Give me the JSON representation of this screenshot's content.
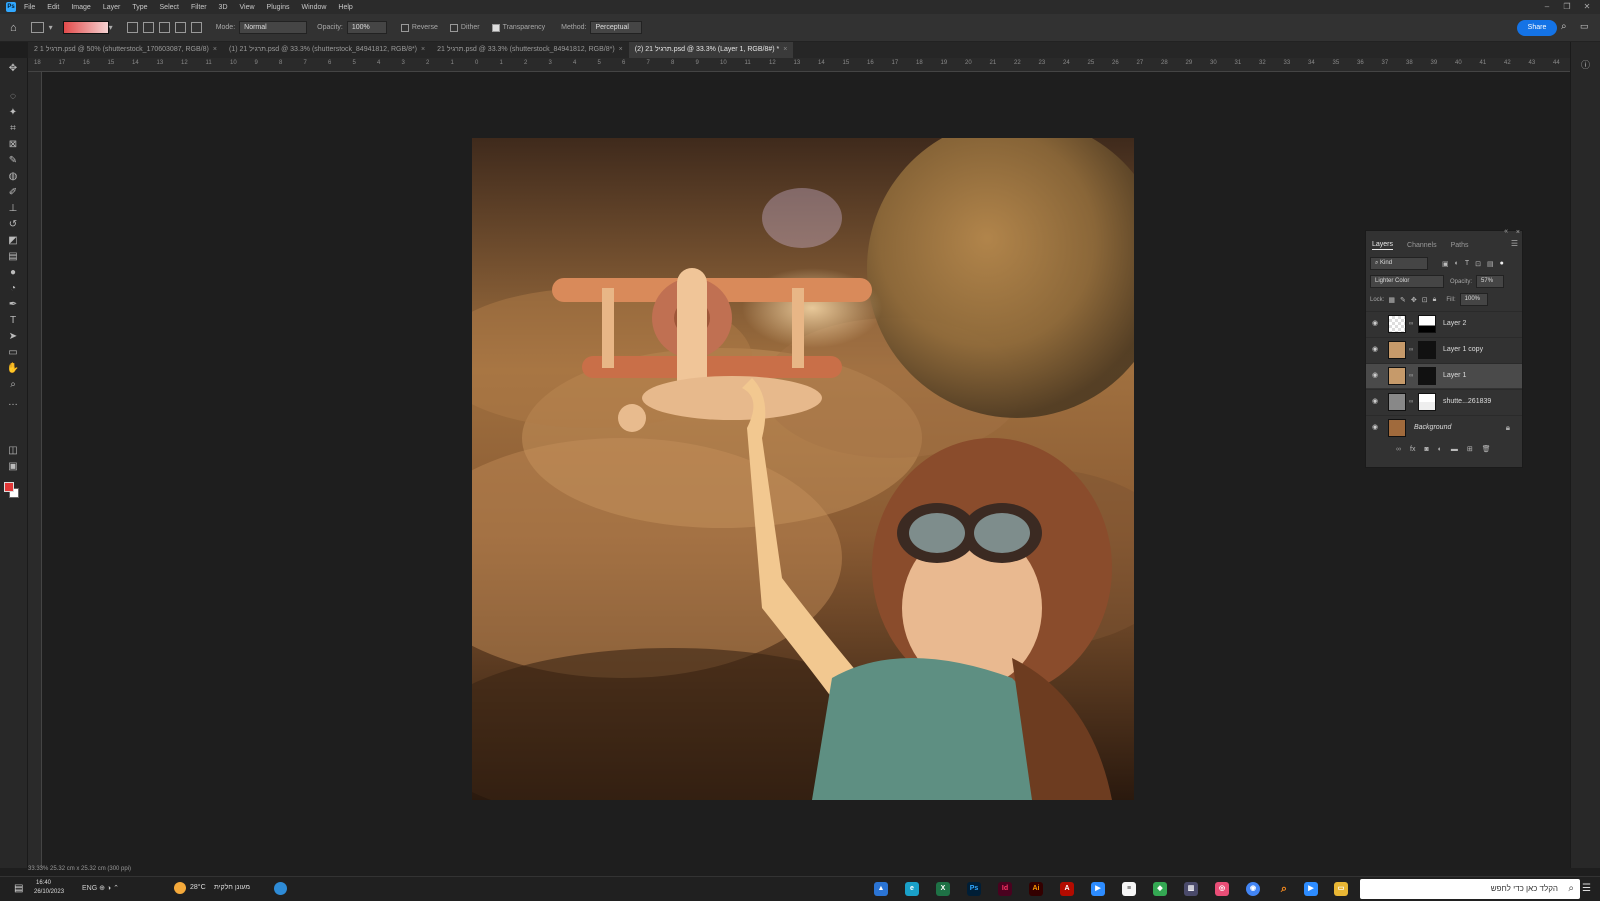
{
  "menubar": {
    "items": [
      "File",
      "Edit",
      "Image",
      "Layer",
      "Type",
      "Select",
      "Filter",
      "3D",
      "View",
      "Plugins",
      "Window",
      "Help"
    ]
  },
  "options": {
    "mode_label": "Mode:",
    "mode_value": "Normal",
    "opacity_label": "Opacity:",
    "opacity_value": "100%",
    "reverse_label": "Reverse",
    "dither_label": "Dither",
    "transparency_label": "Transparency",
    "method_label": "Method:",
    "method_value": "Perceptual",
    "share_label": "Share"
  },
  "tabs": [
    {
      "label": "2 תרגיל 1.psd @ 50% (shutterstock_170603087, RGB/8)"
    },
    {
      "label": "תרגיל 21 (1).psd @ 33.3% (shutterstock_84941812, RGB/8*)"
    },
    {
      "label": "תרגיל 21.psd @ 33.3% (shutterstock_84941812, RGB/8*)"
    },
    {
      "label": "תרגיל 21 (2).psd @ 33.3% (Layer 1, RGB/8#) *"
    }
  ],
  "ruler_top": [
    "18",
    "17",
    "16",
    "15",
    "14",
    "13",
    "12",
    "11",
    "10",
    "9",
    "8",
    "7",
    "6",
    "5",
    "4",
    "3",
    "2",
    "1",
    "0",
    "1",
    "2",
    "3",
    "4",
    "5",
    "6",
    "7",
    "8",
    "9",
    "10",
    "11",
    "12",
    "13",
    "14",
    "15",
    "16",
    "17",
    "18",
    "19",
    "20",
    "21",
    "22",
    "23",
    "24",
    "25",
    "26",
    "27",
    "28",
    "29",
    "30",
    "31",
    "32",
    "33",
    "34",
    "35",
    "36",
    "37",
    "38",
    "39",
    "40",
    "41",
    "42",
    "43",
    "44"
  ],
  "layers_panel": {
    "tabs": [
      "Layers",
      "Channels",
      "Paths"
    ],
    "filter_kind": "Kind",
    "blend_mode": "Lighter Color",
    "opacity_label": "Opacity:",
    "opacity_value": "57%",
    "lock_label": "Lock:",
    "fill_label": "Fill:",
    "fill_value": "100%",
    "layers": [
      {
        "name": "Layer 2"
      },
      {
        "name": "Layer 1 copy"
      },
      {
        "name": "Layer 1"
      },
      {
        "name": "shutte...261839"
      },
      {
        "name": "Background"
      }
    ]
  },
  "status": {
    "text": "33.33%   25.32 cm x 25.32 cm (300 ppi)"
  },
  "taskbar": {
    "weather": "28°C",
    "weather_desc": "מעונן חלקית",
    "time": "16:40",
    "date": "26/10/2023",
    "search_placeholder": "הקלד כאן כדי לחפש"
  },
  "colors": {
    "accent": "#1473e6",
    "foreground_swatch": "#e23838",
    "background_swatch": "#ffffff"
  }
}
